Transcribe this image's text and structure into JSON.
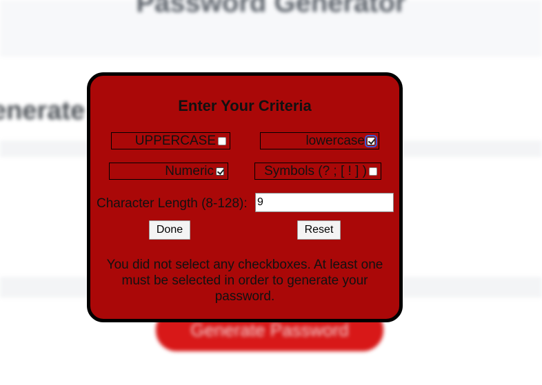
{
  "background": {
    "title": "Password Generator",
    "subtitle": "enerate a",
    "generate_button_label": "Generate Password"
  },
  "modal": {
    "title": "Enter Your Criteria",
    "criteria": {
      "uppercase": {
        "label": "UPPERCASE",
        "checked": false
      },
      "lowercase": {
        "label": "lowercase",
        "checked": true
      },
      "numeric": {
        "label": "Numeric",
        "checked": true
      },
      "symbols": {
        "label": "Symbols (? ; [ ! ] )",
        "checked": false
      }
    },
    "length_label": "Character Length (8-128):",
    "length_value": "9",
    "done_label": "Done",
    "reset_label": "Reset",
    "error_message": "You did not select any checkboxes. At least one must be selected in order to generate your password."
  },
  "colors": {
    "modal_background": "#aa0808",
    "modal_border": "#000000",
    "generate_button": "#d81818"
  }
}
